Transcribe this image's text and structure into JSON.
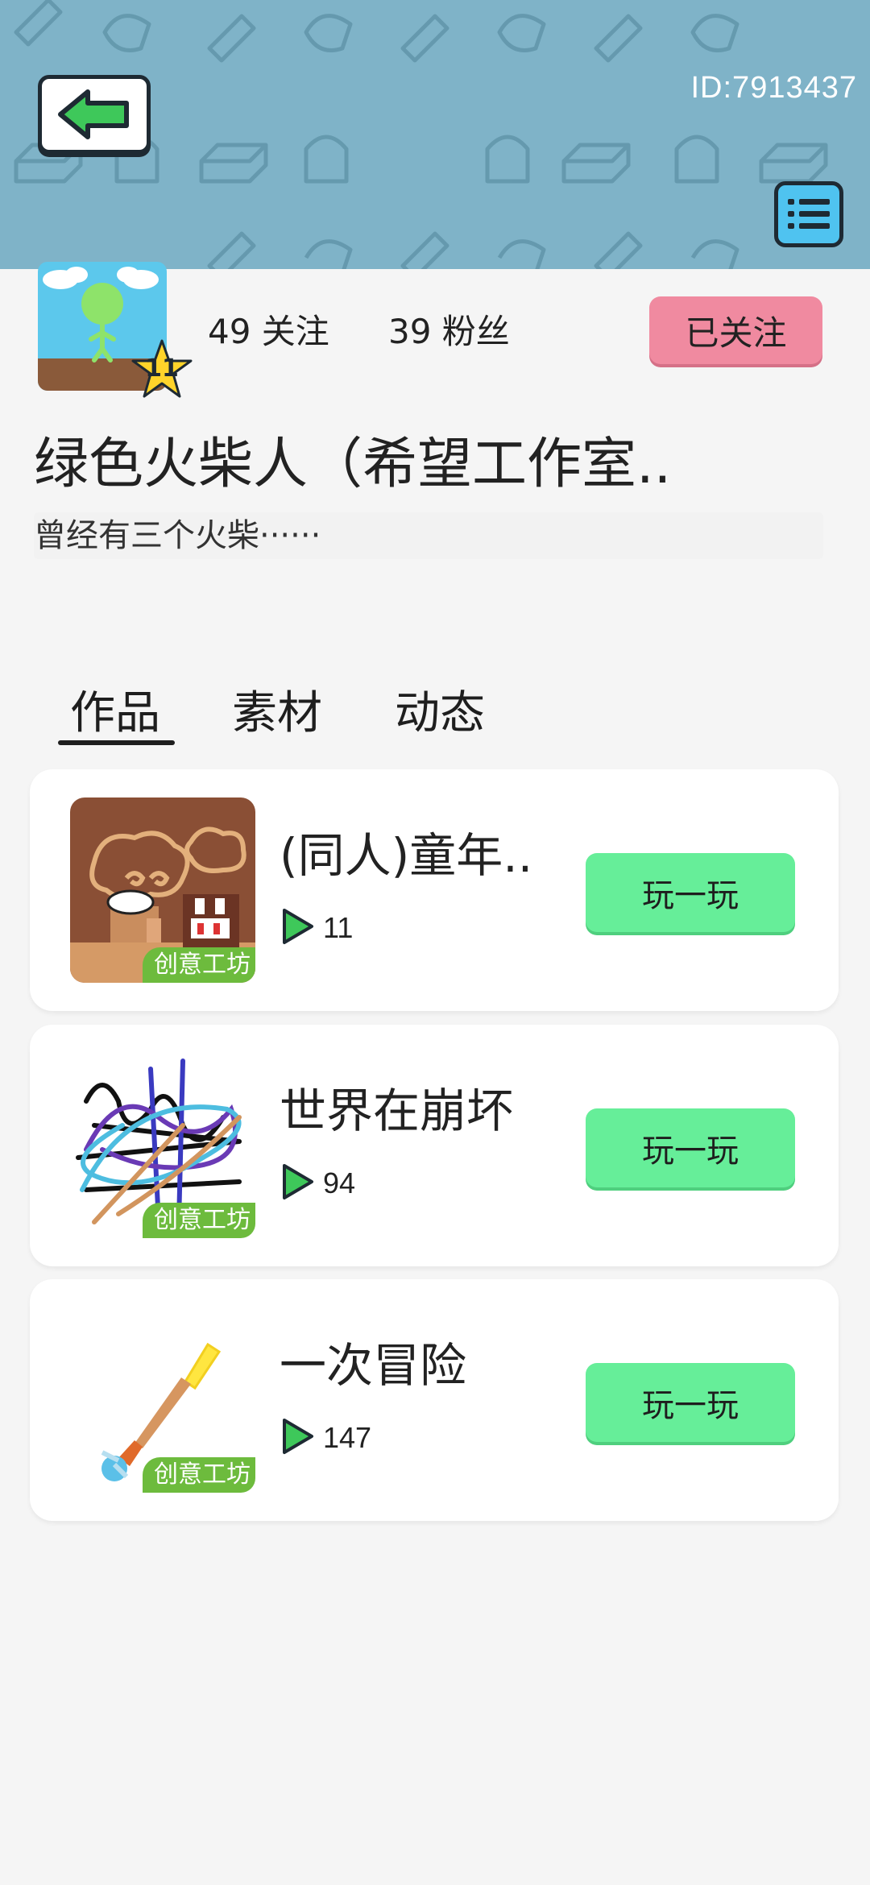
{
  "header": {
    "user_id": "ID:7913437",
    "back_icon": "arrow-left-icon",
    "menu_icon": "list-menu-icon"
  },
  "profile": {
    "level": "11",
    "following_label": "49 关注",
    "followers_label": "39 粉丝",
    "follow_status": "已关注",
    "username": "绿色火柴人（希望工作室..",
    "bio": "曾经有三个火柴······"
  },
  "tabs": [
    {
      "label": "作品",
      "active": true
    },
    {
      "label": "素材",
      "active": false
    },
    {
      "label": "动态",
      "active": false
    }
  ],
  "works": [
    {
      "title": "(同人)童年..",
      "plays": "11",
      "tag": "创意工坊",
      "button": "玩一玩"
    },
    {
      "title": "世界在崩坏",
      "plays": "94",
      "tag": "创意工坊",
      "button": "玩一玩"
    },
    {
      "title": "一次冒险",
      "plays": "147",
      "tag": "创意工坊",
      "button": "玩一玩"
    }
  ],
  "colors": {
    "banner": "#7fb3c8",
    "follow_button": "#f08aa0",
    "play_button": "#66ee99",
    "workshop_tag": "#6dbb3d"
  }
}
